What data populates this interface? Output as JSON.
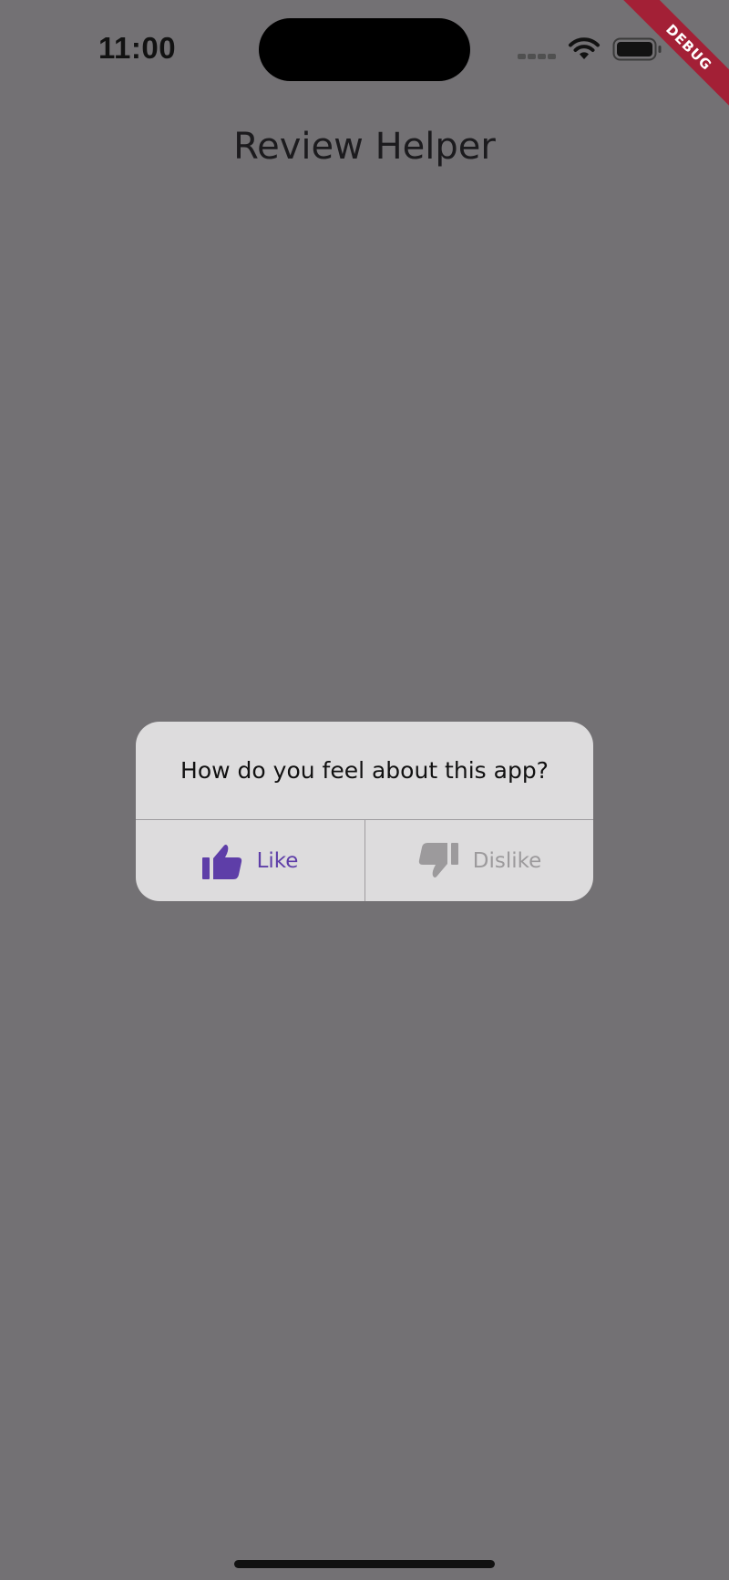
{
  "status_bar": {
    "time": "11:00",
    "icons": [
      "signal-dots-icon",
      "wifi-icon",
      "battery-icon"
    ]
  },
  "debug_banner": {
    "label": "DEBUG",
    "color": "#a32036"
  },
  "app_bar": {
    "title": "Review Helper"
  },
  "dialog": {
    "message": "How do you feel about this app?",
    "like_button": {
      "label": "Like",
      "icon": "thumbs-up-icon",
      "color": "#5e3ea8"
    },
    "dislike_button": {
      "label": "Dislike",
      "icon": "thumbs-down-icon",
      "color": "#9c9a9c"
    }
  },
  "colors": {
    "overlay_background": "#737174",
    "dialog_background": "#dddcdd"
  }
}
